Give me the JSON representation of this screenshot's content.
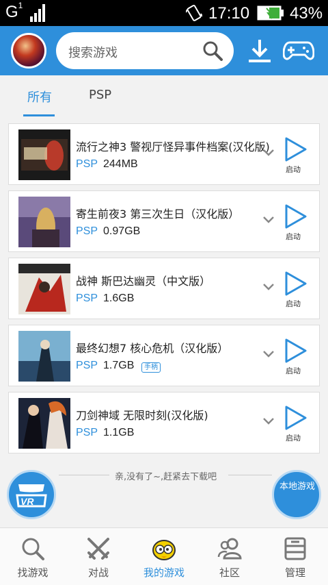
{
  "status_bar": {
    "network": "G",
    "network_sup": "1",
    "time": "17:10",
    "battery_pct": "43%"
  },
  "header": {
    "search_placeholder": "搜索游戏",
    "icons": [
      "avatar",
      "search-icon",
      "download-icon",
      "gamepad-icon"
    ]
  },
  "tabs": [
    {
      "label": "所有",
      "active": true
    },
    {
      "label": "PSP",
      "active": false
    }
  ],
  "games": [
    {
      "title": "流行之神3 警视厅怪异事件档案(汉化版)",
      "platform": "PSP",
      "size": "244MB",
      "badge": "",
      "action": "启动"
    },
    {
      "title": "寄生前夜3 第三次生日（汉化版）",
      "platform": "PSP",
      "size": "0.97GB",
      "badge": "",
      "action": "启动"
    },
    {
      "title": "战神 斯巴达幽灵（中文版）",
      "platform": "PSP",
      "size": "1.6GB",
      "badge": "",
      "action": "启动"
    },
    {
      "title": "最终幻想7 核心危机（汉化版）",
      "platform": "PSP",
      "size": "1.7GB",
      "badge": "手柄",
      "action": "启动"
    },
    {
      "title": "刀剑神域 无限时刻(汉化版)",
      "platform": "PSP",
      "size": "1.1GB",
      "badge": "",
      "action": "启动"
    }
  ],
  "end_text": "亲,没有了~,赶紧去下载吧",
  "vr_button": {
    "label": "VR"
  },
  "local_button": {
    "label": "本地游戏"
  },
  "bottom_nav": [
    {
      "label": "找游戏",
      "icon": "magnifier-icon",
      "active": false
    },
    {
      "label": "对战",
      "icon": "crossed-swords-icon",
      "active": false
    },
    {
      "label": "我的游戏",
      "icon": "mascot-icon",
      "active": true
    },
    {
      "label": "社区",
      "icon": "people-icon",
      "active": false
    },
    {
      "label": "管理",
      "icon": "manage-icon",
      "active": false
    }
  ],
  "colors": {
    "accent": "#2e8fdb",
    "statusbar": "#000000",
    "background": "#f2f2f2"
  }
}
